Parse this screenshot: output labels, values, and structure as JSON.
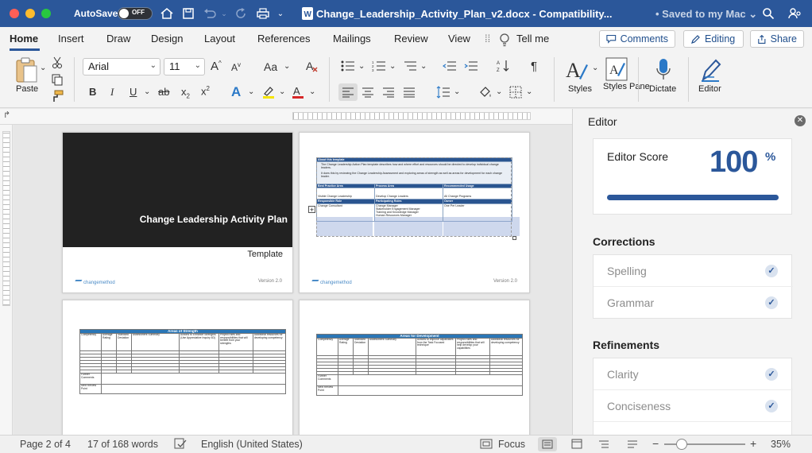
{
  "titlebar": {
    "autosave_label": "AutoSave",
    "autosave_state": "OFF",
    "document_title": "Change_Leadership_Activity_Plan_v2.docx - Compatibility...",
    "saved_status": "• Saved to my Mac ⌄"
  },
  "tabs": {
    "items": [
      "Home",
      "Insert",
      "Draw",
      "Design",
      "Layout",
      "References",
      "Mailings",
      "Review",
      "View"
    ],
    "tell_me": "Tell me",
    "comments": "Comments",
    "editing": "Editing",
    "share": "Share"
  },
  "ribbon": {
    "paste_label": "Paste",
    "font_name": "Arial",
    "font_size": "11",
    "styles_label": "Styles",
    "styles_pane_label": "Styles Pane",
    "dictate_label": "Dictate",
    "editor_label": "Editor"
  },
  "document": {
    "cover_title": "Change Leadership Activity Plan",
    "cover_subtitle": "Template",
    "logo_text": "changemethod",
    "version_text": "Version 2.0",
    "page2": {
      "about_heading": "About this template",
      "about_bullets": [
        "The Change Leadership Action Plan template describes how and where effort and resources should be directed to develop individual change leaders.",
        "It does this by reviewing the Change Leadership Assessment and exploring areas of strength as well as areas for development for each change leader."
      ],
      "col_headers_1": [
        "Best Practice Area",
        "Process Area",
        "Recommended Usage"
      ],
      "row_1": [
        "Visible Change Leadership",
        "Develop Change Leaders",
        "All Change Programs"
      ],
      "col_headers_2": [
        "Responsible Role",
        "Participating Roles",
        "Owner"
      ],
      "row_2_role": "Change Consultant",
      "row_2_participating": [
        "Change Manager",
        "Stakeholder Engagement Manager",
        "Training and Knowledge Manager",
        "Human Resources Manager"
      ],
      "row_2_owner": "One Per Leader"
    },
    "page3": {
      "table_title": "Areas of Strength",
      "headers": [
        "Competency",
        "Average Rating",
        "Standard Deviation",
        "Assessment Summary",
        "Actions to Enhance Strengths (Use Appreciative Inquiry 4D)",
        "Project roles and responsibilities that will benefit from your strengths",
        "Additional resources for developing competency"
      ],
      "further_comments": "Further Comments",
      "next_review": "Next Review Point"
    },
    "page4": {
      "table_title": "Areas for Development",
      "headers": [
        "Competency",
        "Average Rating",
        "Standard Deviation",
        "Assessment Summary",
        "Actions to improve capabilities from the Task Focused technique",
        "Project roles and responsibilities that will help develop your capabilities",
        "Additional resources for developing competency"
      ],
      "further_comments": "Further Comments",
      "next_review": "Next Review Point"
    }
  },
  "editor": {
    "title": "Editor",
    "score_label": "Editor Score",
    "score_value": "100",
    "score_unit": "%",
    "score_fraction": 1.0,
    "corrections_heading": "Corrections",
    "corrections": [
      "Spelling",
      "Grammar"
    ],
    "refinements_heading": "Refinements",
    "refinements": [
      "Clarity",
      "Conciseness"
    ]
  },
  "statusbar": {
    "page": "Page 2 of 4",
    "words": "17 of 168 words",
    "language": "English (United States)",
    "focus": "Focus",
    "zoom": "35%"
  },
  "colors": {
    "brand": "#2b579a",
    "title_bar": "#2b579a",
    "table_header": "#2a5590"
  }
}
